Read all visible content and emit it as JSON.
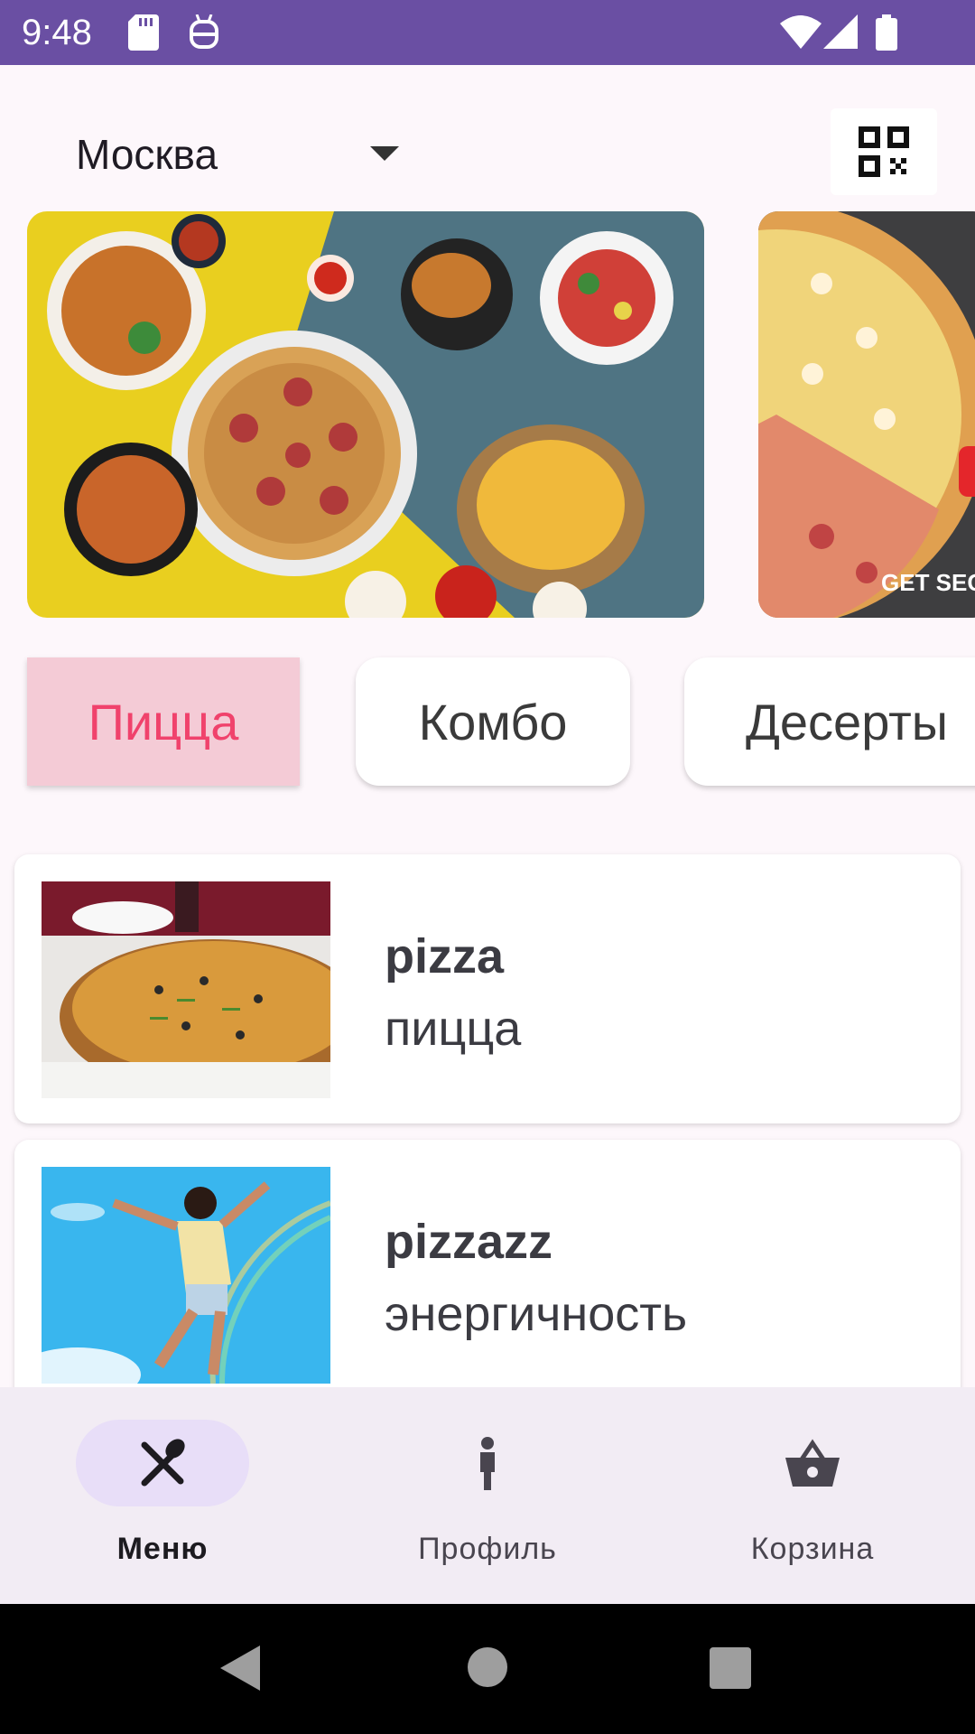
{
  "status_bar": {
    "time": "9:48"
  },
  "header": {
    "city": "Москва"
  },
  "categories": [
    {
      "label": "Пицца",
      "active": true
    },
    {
      "label": "Комбо",
      "active": false
    },
    {
      "label": "Десерты",
      "active": false
    }
  ],
  "banners": [
    {
      "text": ""
    },
    {
      "text": "GET SEC"
    }
  ],
  "products": [
    {
      "title": "pizza",
      "subtitle": "пицца"
    },
    {
      "title": "pizzazz",
      "subtitle": "энергичность"
    }
  ],
  "bottom_nav": {
    "items": [
      {
        "label": "Меню",
        "icon": "utensils-icon",
        "active": true
      },
      {
        "label": "Профиль",
        "icon": "person-icon",
        "active": false
      },
      {
        "label": "Корзина",
        "icon": "basket-icon",
        "active": false
      }
    ]
  },
  "colors": {
    "status_bar": "#6a4fa3",
    "accent": "#f0426c",
    "chip_active_bg": "#f4cbd6",
    "nav_pill": "#e8def8"
  }
}
